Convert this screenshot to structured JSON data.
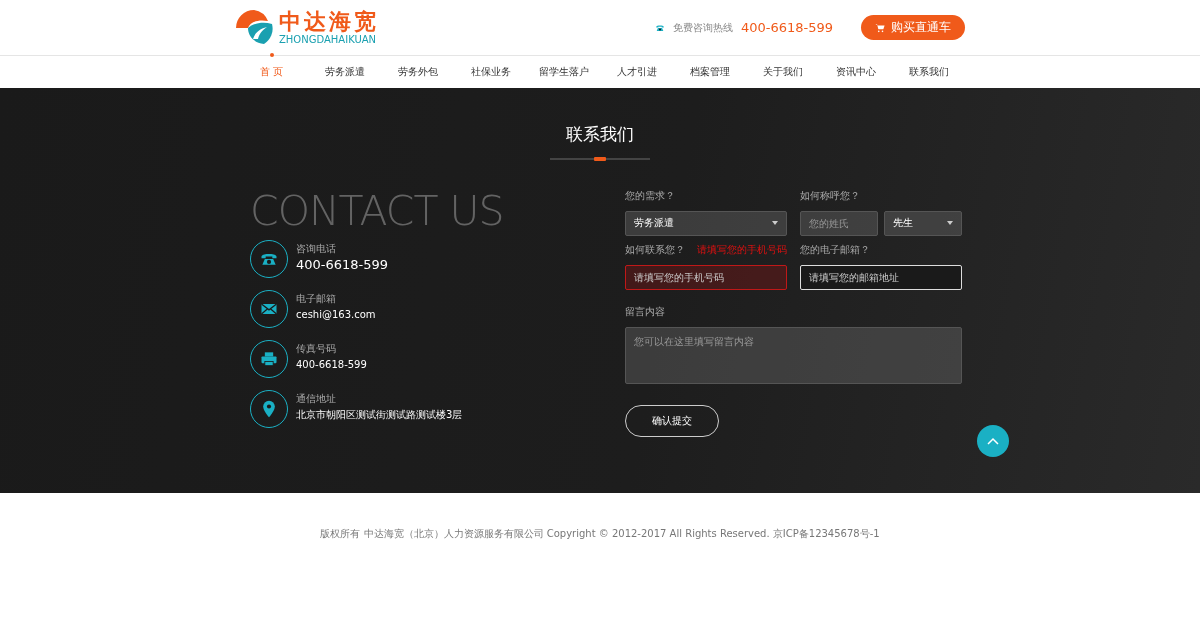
{
  "header": {
    "logo_cn": "中达海宽",
    "logo_en": "ZHONGDAHAIKUAN",
    "hotline_label": "免费咨询热线",
    "hotline": "400-6618-599",
    "buy_button": "购买直通车"
  },
  "nav": [
    {
      "label": "首 页",
      "selected": true
    },
    {
      "label": "劳务派遣",
      "selected": false
    },
    {
      "label": "劳务外包",
      "selected": false
    },
    {
      "label": "社保业务",
      "selected": false
    },
    {
      "label": "留学生落户",
      "selected": false
    },
    {
      "label": "人才引进",
      "selected": false
    },
    {
      "label": "档案管理",
      "selected": false
    },
    {
      "label": "关于我们",
      "selected": false
    },
    {
      "label": "资讯中心",
      "selected": false
    },
    {
      "label": "联系我们",
      "selected": false
    }
  ],
  "section_title": "联系我们",
  "contact_heading": "CONTACT US",
  "contacts": [
    {
      "kind": "phone",
      "label": "咨询电话",
      "value": "400-6618-599",
      "large": true
    },
    {
      "kind": "email",
      "label": "电子邮箱",
      "value": "ceshi@163.com",
      "large": false
    },
    {
      "kind": "fax",
      "label": "传真号码",
      "value": "400-6618-599",
      "large": false
    },
    {
      "kind": "address",
      "label": "通信地址",
      "value": "北京市朝阳区测试街测试路测试楼3层",
      "large": false
    }
  ],
  "form": {
    "need_label": "您的需求？",
    "need_value": "劳务派遣",
    "name_label": "如何称呼您？",
    "name_placeholder": "您的姓氏",
    "title_value": "先生",
    "contact_label": "如何联系您？",
    "contact_error": "请填写您的手机号码",
    "contact_placeholder": "请填写您的手机号码",
    "contact_invalid": true,
    "email_label": "您的电子邮箱？",
    "email_placeholder": "请填写您的邮箱地址",
    "email_focused": true,
    "message_label": "留言内容",
    "message_placeholder": "您可以在这里填写留言内容",
    "submit": "确认提交"
  },
  "footer": "版权所有 中达海宽（北京）人力资源服务有限公司  Copyright © 2012-2017 All Rights Reserved. 京ICP备12345678号-1"
}
